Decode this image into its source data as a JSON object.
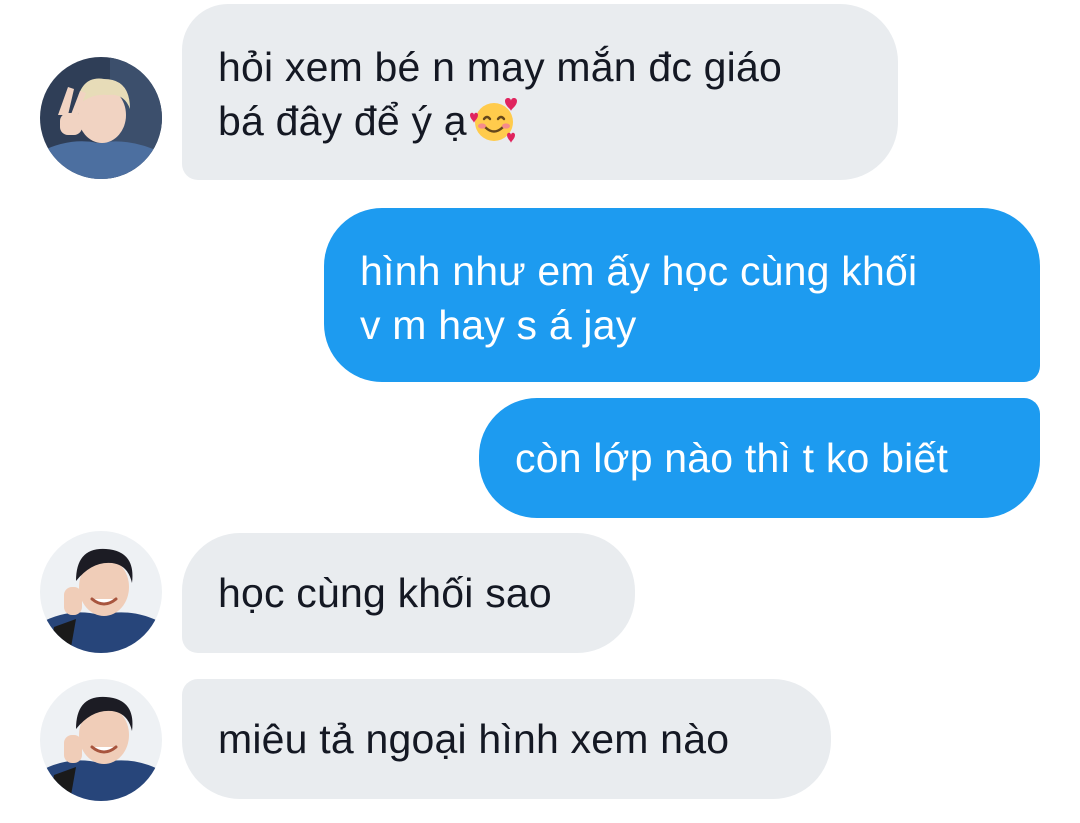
{
  "messages": [
    {
      "direction": "incoming",
      "avatar": "avatar-blond",
      "lines": [
        "hỏi xem bé n may mắn đc giáo",
        "bá đây để ý ạ"
      ],
      "emoji": "smiling-face-with-hearts"
    },
    {
      "direction": "outgoing",
      "lines": [
        "hình như em ấy học cùng khối",
        "v m hay s á jay"
      ]
    },
    {
      "direction": "outgoing",
      "lines": [
        "còn lớp nào thì t ko biết"
      ]
    },
    {
      "direction": "incoming",
      "avatar": "avatar-dark-hair",
      "lines": [
        "học cùng khối sao"
      ]
    },
    {
      "direction": "incoming",
      "avatar": "avatar-dark-hair",
      "lines": [
        "miêu tả ngoại hình xem nào"
      ]
    }
  ],
  "colors": {
    "incoming_bubble": "#e9ecef",
    "outgoing_bubble": "#1d9bf0",
    "incoming_text": "#141823",
    "outgoing_text": "#ffffff",
    "background": "#ffffff"
  }
}
